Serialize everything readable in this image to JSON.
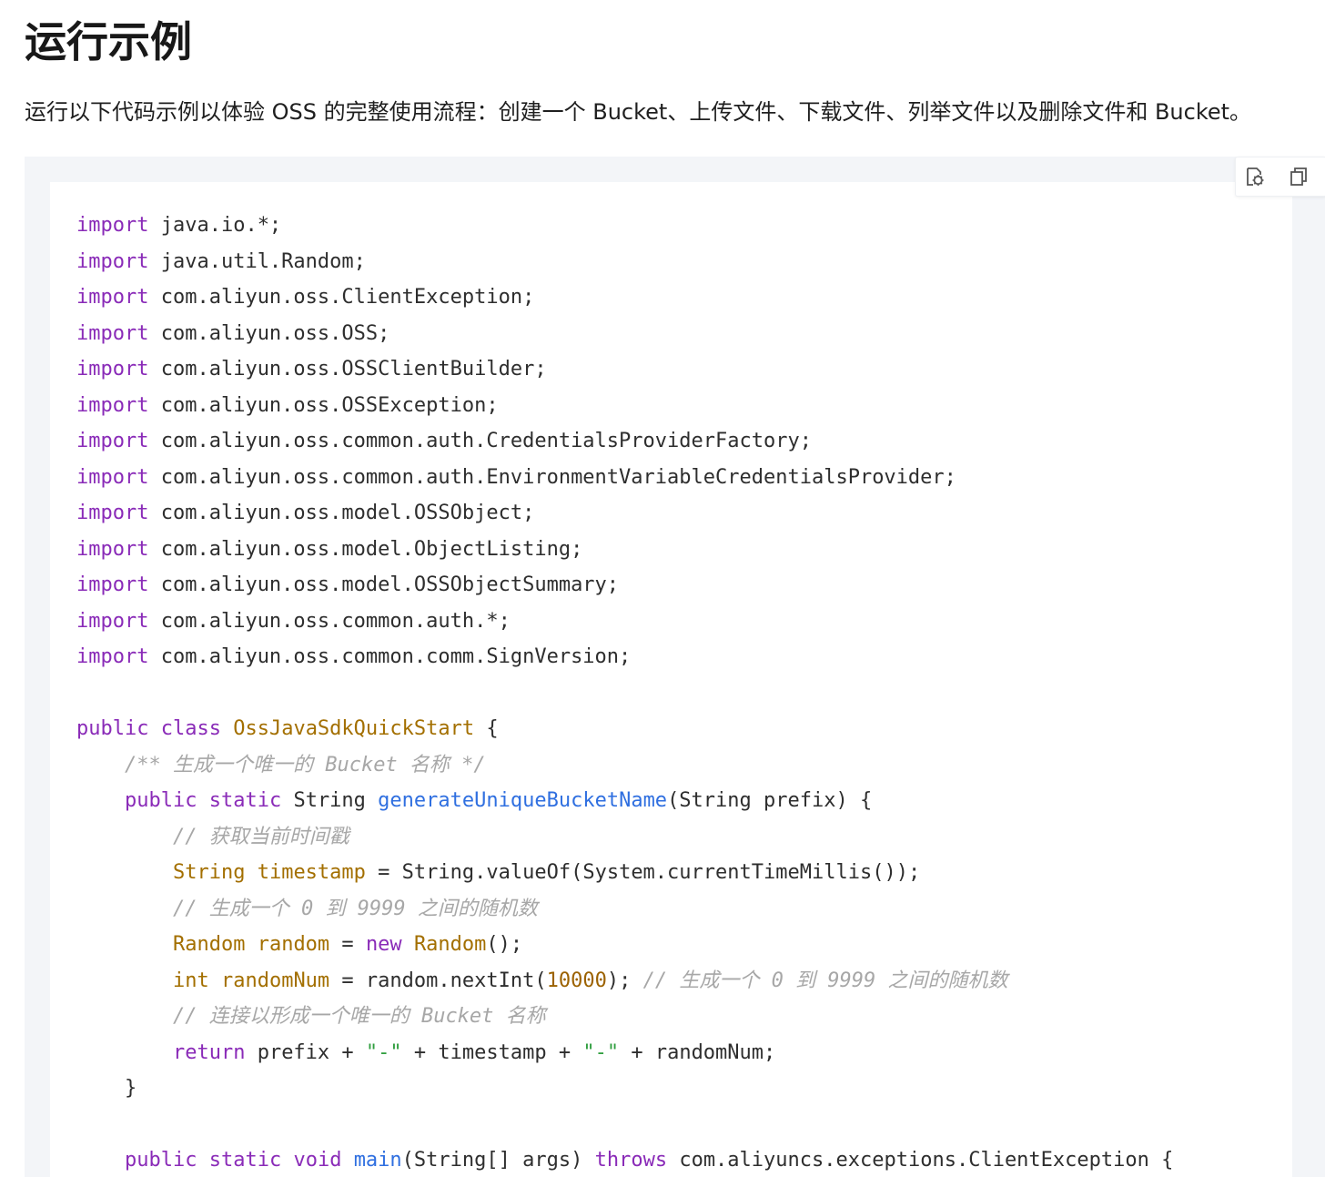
{
  "page": {
    "title": "运行示例",
    "intro": "运行以下代码示例以体验 OSS 的完整使用流程：创建一个 Bucket、上传文件、下载文件、列举文件以及删除文件和 Bucket。"
  },
  "toolbar": {
    "run_icon": "run-in-cloud-shell-icon",
    "copy_icon": "copy-icon"
  },
  "code": {
    "language": "java",
    "lines": [
      [
        {
          "t": "kw",
          "v": "import"
        },
        {
          "t": "",
          "v": " java.io.*;"
        }
      ],
      [
        {
          "t": "kw",
          "v": "import"
        },
        {
          "t": "",
          "v": " java.util.Random;"
        }
      ],
      [
        {
          "t": "kw",
          "v": "import"
        },
        {
          "t": "",
          "v": " com.aliyun.oss.ClientException;"
        }
      ],
      [
        {
          "t": "kw",
          "v": "import"
        },
        {
          "t": "",
          "v": " com.aliyun.oss.OSS;"
        }
      ],
      [
        {
          "t": "kw",
          "v": "import"
        },
        {
          "t": "",
          "v": " com.aliyun.oss.OSSClientBuilder;"
        }
      ],
      [
        {
          "t": "kw",
          "v": "import"
        },
        {
          "t": "",
          "v": " com.aliyun.oss.OSSException;"
        }
      ],
      [
        {
          "t": "kw",
          "v": "import"
        },
        {
          "t": "",
          "v": " com.aliyun.oss.common.auth.CredentialsProviderFactory;"
        }
      ],
      [
        {
          "t": "kw",
          "v": "import"
        },
        {
          "t": "",
          "v": " com.aliyun.oss.common.auth.EnvironmentVariableCredentialsProvider;"
        }
      ],
      [
        {
          "t": "kw",
          "v": "import"
        },
        {
          "t": "",
          "v": " com.aliyun.oss.model.OSSObject;"
        }
      ],
      [
        {
          "t": "kw",
          "v": "import"
        },
        {
          "t": "",
          "v": " com.aliyun.oss.model.ObjectListing;"
        }
      ],
      [
        {
          "t": "kw",
          "v": "import"
        },
        {
          "t": "",
          "v": " com.aliyun.oss.model.OSSObjectSummary;"
        }
      ],
      [
        {
          "t": "kw",
          "v": "import"
        },
        {
          "t": "",
          "v": " com.aliyun.oss.common.auth.*;"
        }
      ],
      [
        {
          "t": "kw",
          "v": "import"
        },
        {
          "t": "",
          "v": " com.aliyun.oss.common.comm.SignVersion;"
        }
      ],
      [],
      [
        {
          "t": "kw",
          "v": "public"
        },
        {
          "t": "",
          "v": " "
        },
        {
          "t": "kw",
          "v": "class"
        },
        {
          "t": "",
          "v": " "
        },
        {
          "t": "ty",
          "v": "OssJavaSdkQuickStart"
        },
        {
          "t": "",
          "v": " {"
        }
      ],
      [
        {
          "t": "",
          "v": "    "
        },
        {
          "t": "cm",
          "v": "/** 生成一个唯一的 Bucket 名称 */"
        }
      ],
      [
        {
          "t": "",
          "v": "    "
        },
        {
          "t": "kw",
          "v": "public"
        },
        {
          "t": "",
          "v": " "
        },
        {
          "t": "kw",
          "v": "static"
        },
        {
          "t": "",
          "v": " String "
        },
        {
          "t": "fn",
          "v": "generateUniqueBucketName"
        },
        {
          "t": "",
          "v": "(String prefix) {"
        }
      ],
      [
        {
          "t": "",
          "v": "        "
        },
        {
          "t": "cm",
          "v": "// 获取当前时间戳"
        }
      ],
      [
        {
          "t": "",
          "v": "        "
        },
        {
          "t": "ty",
          "v": "String"
        },
        {
          "t": "",
          "v": " "
        },
        {
          "t": "ty",
          "v": "timestamp"
        },
        {
          "t": "",
          "v": " = String.valueOf(System.currentTimeMillis());"
        }
      ],
      [
        {
          "t": "",
          "v": "        "
        },
        {
          "t": "cm",
          "v": "// 生成一个 0 到 9999 之间的随机数"
        }
      ],
      [
        {
          "t": "",
          "v": "        "
        },
        {
          "t": "ty",
          "v": "Random"
        },
        {
          "t": "",
          "v": " "
        },
        {
          "t": "ty",
          "v": "random"
        },
        {
          "t": "",
          "v": " = "
        },
        {
          "t": "kw",
          "v": "new"
        },
        {
          "t": "",
          "v": " "
        },
        {
          "t": "ty",
          "v": "Random"
        },
        {
          "t": "",
          "v": "();"
        }
      ],
      [
        {
          "t": "",
          "v": "        "
        },
        {
          "t": "ty",
          "v": "int"
        },
        {
          "t": "",
          "v": " "
        },
        {
          "t": "ty",
          "v": "randomNum"
        },
        {
          "t": "",
          "v": " = random.nextInt("
        },
        {
          "t": "nm",
          "v": "10000"
        },
        {
          "t": "",
          "v": "); "
        },
        {
          "t": "cm",
          "v": "// 生成一个 0 到 9999 之间的随机数"
        }
      ],
      [
        {
          "t": "",
          "v": "        "
        },
        {
          "t": "cm",
          "v": "// 连接以形成一个唯一的 Bucket 名称"
        }
      ],
      [
        {
          "t": "",
          "v": "        "
        },
        {
          "t": "kw",
          "v": "return"
        },
        {
          "t": "",
          "v": " prefix + "
        },
        {
          "t": "st",
          "v": "\"-\""
        },
        {
          "t": "",
          "v": " + timestamp + "
        },
        {
          "t": "st",
          "v": "\"-\""
        },
        {
          "t": "",
          "v": " + randomNum;"
        }
      ],
      [
        {
          "t": "",
          "v": "    }"
        }
      ],
      [],
      [
        {
          "t": "",
          "v": "    "
        },
        {
          "t": "kw",
          "v": "public"
        },
        {
          "t": "",
          "v": " "
        },
        {
          "t": "kw",
          "v": "static"
        },
        {
          "t": "",
          "v": " "
        },
        {
          "t": "kw",
          "v": "void"
        },
        {
          "t": "",
          "v": " "
        },
        {
          "t": "fn",
          "v": "main"
        },
        {
          "t": "",
          "v": "(String[] args) "
        },
        {
          "t": "kw",
          "v": "throws"
        },
        {
          "t": "",
          "v": " com.aliyuncs.exceptions.ClientException {"
        }
      ]
    ]
  }
}
